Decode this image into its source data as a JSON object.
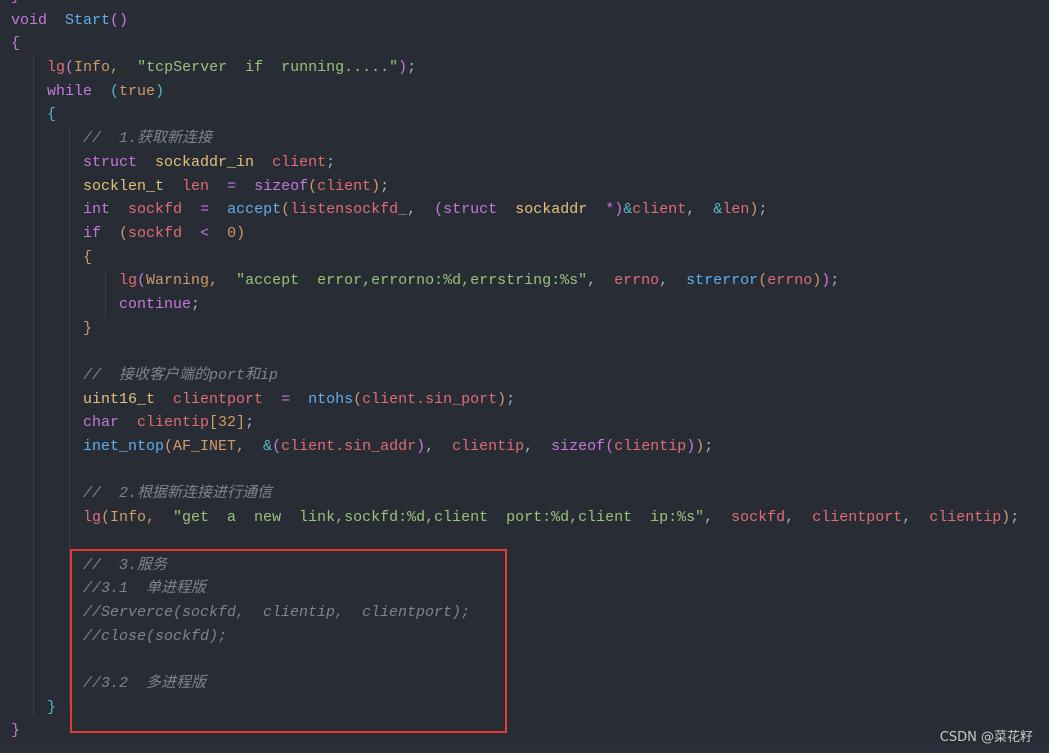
{
  "colors": {
    "background": "#282c34",
    "keyword": "#c678dd",
    "function": "#61afef",
    "variable": "#e06c75",
    "type": "#e5c07b",
    "string": "#98c379",
    "comment": "#7f848e",
    "highlight_box": "#e53935"
  },
  "watermark": "CSDN @菜花籽",
  "lines": [
    {
      "indent": 0,
      "tokens": [
        [
          "k",
          "}"
        ]
      ]
    },
    {
      "indent": 0,
      "tokens": [
        [
          "k",
          "void"
        ],
        [
          "p",
          "  "
        ],
        [
          "f",
          "Start"
        ],
        [
          "k",
          "()"
        ]
      ]
    },
    {
      "indent": 0,
      "tokens": [
        [
          "k",
          "{"
        ]
      ]
    },
    {
      "indent": 1,
      "tokens": [
        [
          "v",
          "lg"
        ],
        [
          "k",
          "("
        ],
        [
          "o",
          "Info,"
        ],
        [
          "p",
          "  "
        ],
        [
          "s",
          "\"tcpServer  if  running.....\""
        ],
        [
          "k",
          ")"
        ],
        [
          "p",
          ";"
        ]
      ]
    },
    {
      "indent": 1,
      "tokens": [
        [
          "k",
          "while"
        ],
        [
          "p",
          "  "
        ],
        [
          "n",
          "("
        ],
        [
          "o",
          "true"
        ],
        [
          "n",
          ")"
        ]
      ]
    },
    {
      "indent": 1,
      "tokens": [
        [
          "n",
          "{"
        ]
      ]
    },
    {
      "indent": 2,
      "tokens": [
        [
          "c",
          "//  1.获取新连接"
        ]
      ]
    },
    {
      "indent": 2,
      "tokens": [
        [
          "k",
          "struct"
        ],
        [
          "p",
          "  "
        ],
        [
          "t",
          "sockaddr_in"
        ],
        [
          "p",
          "  "
        ],
        [
          "v",
          "client"
        ],
        [
          "p",
          ";"
        ]
      ]
    },
    {
      "indent": 2,
      "tokens": [
        [
          "t",
          "socklen_t"
        ],
        [
          "p",
          "  "
        ],
        [
          "v",
          "len"
        ],
        [
          "p",
          "  "
        ],
        [
          "k",
          "="
        ],
        [
          "p",
          "  "
        ],
        [
          "k",
          "sizeof"
        ],
        [
          "o",
          "("
        ],
        [
          "v",
          "client"
        ],
        [
          "o",
          ")"
        ],
        [
          "p",
          ";"
        ]
      ]
    },
    {
      "indent": 2,
      "tokens": [
        [
          "k",
          "int"
        ],
        [
          "p",
          "  "
        ],
        [
          "v",
          "sockfd"
        ],
        [
          "p",
          "  "
        ],
        [
          "k",
          "="
        ],
        [
          "p",
          "  "
        ],
        [
          "f",
          "accept"
        ],
        [
          "o",
          "("
        ],
        [
          "v",
          "listensockfd_"
        ],
        [
          "p",
          ",  "
        ],
        [
          "k",
          "(struct"
        ],
        [
          "p",
          "  "
        ],
        [
          "t",
          "sockaddr"
        ],
        [
          "p",
          "  "
        ],
        [
          "k",
          "*)"
        ],
        [
          "n",
          "&"
        ],
        [
          "v",
          "client"
        ],
        [
          "p",
          ",  "
        ],
        [
          "n",
          "&"
        ],
        [
          "v",
          "len"
        ],
        [
          "o",
          ")"
        ],
        [
          "p",
          ";"
        ]
      ]
    },
    {
      "indent": 2,
      "tokens": [
        [
          "k",
          "if"
        ],
        [
          "p",
          "  "
        ],
        [
          "o",
          "("
        ],
        [
          "v",
          "sockfd"
        ],
        [
          "p",
          "  "
        ],
        [
          "k",
          "<"
        ],
        [
          "p",
          "  "
        ],
        [
          "o",
          "0)"
        ]
      ]
    },
    {
      "indent": 2,
      "tokens": [
        [
          "o",
          "{"
        ]
      ]
    },
    {
      "indent": 3,
      "tokens": [
        [
          "v",
          "lg"
        ],
        [
          "k",
          "("
        ],
        [
          "o",
          "Warning,"
        ],
        [
          "p",
          "  "
        ],
        [
          "s",
          "\"accept  error,errorno:%d,errstring:%s\""
        ],
        [
          "p",
          ",  "
        ],
        [
          "v",
          "errno"
        ],
        [
          "p",
          ",  "
        ],
        [
          "f",
          "strerror"
        ],
        [
          "o",
          "("
        ],
        [
          "v",
          "errno"
        ],
        [
          "o",
          ")"
        ],
        [
          "k",
          ")"
        ],
        [
          "p",
          ";"
        ]
      ]
    },
    {
      "indent": 3,
      "tokens": [
        [
          "k",
          "continue"
        ],
        [
          "p",
          ";"
        ]
      ]
    },
    {
      "indent": 2,
      "tokens": [
        [
          "o",
          "}"
        ]
      ]
    },
    {
      "indent": 0,
      "tokens": []
    },
    {
      "indent": 2,
      "tokens": [
        [
          "c",
          "//  接收客户端的port和ip"
        ]
      ]
    },
    {
      "indent": 2,
      "tokens": [
        [
          "t",
          "uint16_t"
        ],
        [
          "p",
          "  "
        ],
        [
          "v",
          "clientport"
        ],
        [
          "p",
          "  "
        ],
        [
          "k",
          "="
        ],
        [
          "p",
          "  "
        ],
        [
          "f",
          "ntohs"
        ],
        [
          "o",
          "("
        ],
        [
          "v",
          "client.sin_port"
        ],
        [
          "o",
          ")"
        ],
        [
          "p",
          ";"
        ]
      ]
    },
    {
      "indent": 2,
      "tokens": [
        [
          "k",
          "char"
        ],
        [
          "p",
          "  "
        ],
        [
          "v",
          "clientip"
        ],
        [
          "o",
          "[32]"
        ],
        [
          "p",
          ";"
        ]
      ]
    },
    {
      "indent": 2,
      "tokens": [
        [
          "f",
          "inet_ntop"
        ],
        [
          "o",
          "(AF_INET,"
        ],
        [
          "p",
          "  "
        ],
        [
          "n",
          "&"
        ],
        [
          "k",
          "("
        ],
        [
          "v",
          "client.sin_addr"
        ],
        [
          "k",
          ")"
        ],
        [
          "p",
          ",  "
        ],
        [
          "v",
          "clientip"
        ],
        [
          "p",
          ",  "
        ],
        [
          "k",
          "sizeof"
        ],
        [
          "k",
          "("
        ],
        [
          "v",
          "clientip"
        ],
        [
          "k",
          ")"
        ],
        [
          "o",
          ")"
        ],
        [
          "p",
          ";"
        ]
      ]
    },
    {
      "indent": 0,
      "tokens": []
    },
    {
      "indent": 2,
      "tokens": [
        [
          "c",
          "//  2.根据新连接进行通信"
        ]
      ]
    },
    {
      "indent": 2,
      "tokens": [
        [
          "v",
          "lg"
        ],
        [
          "o",
          "(Info,"
        ],
        [
          "p",
          "  "
        ],
        [
          "s",
          "\"get  a  new  link,sockfd:%d,client  port:%d,client  ip:%s\""
        ],
        [
          "p",
          ",  "
        ],
        [
          "v",
          "sockfd"
        ],
        [
          "p",
          ",  "
        ],
        [
          "v",
          "clientport"
        ],
        [
          "p",
          ",  "
        ],
        [
          "v",
          "clientip"
        ],
        [
          "o",
          ")"
        ],
        [
          "p",
          ";"
        ]
      ]
    },
    {
      "indent": 0,
      "tokens": []
    },
    {
      "indent": 2,
      "tokens": [
        [
          "c",
          "//  3.服务"
        ]
      ]
    },
    {
      "indent": 2,
      "tokens": [
        [
          "c",
          "//3.1  单进程版"
        ]
      ]
    },
    {
      "indent": 2,
      "tokens": [
        [
          "c",
          "//Serverce(sockfd,  clientip,  clientport);"
        ]
      ]
    },
    {
      "indent": 2,
      "tokens": [
        [
          "c",
          "//close(sockfd);"
        ]
      ]
    },
    {
      "indent": 0,
      "tokens": []
    },
    {
      "indent": 2,
      "tokens": [
        [
          "c",
          "//3.2  多进程版"
        ]
      ]
    },
    {
      "indent": 1,
      "tokens": [
        [
          "n",
          "}"
        ]
      ]
    },
    {
      "indent": 0,
      "tokens": [
        [
          "k",
          "}"
        ]
      ]
    }
  ]
}
